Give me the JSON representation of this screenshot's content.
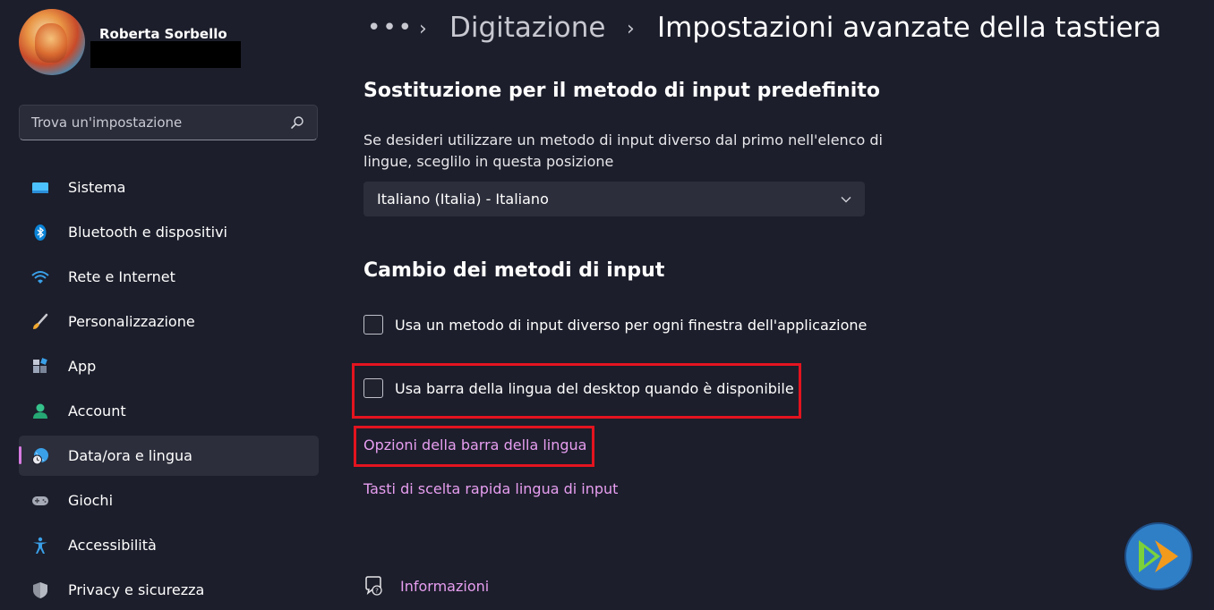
{
  "user": {
    "name": "Roberta Sorbello"
  },
  "search": {
    "placeholder": "Trova un'impostazione"
  },
  "nav": {
    "items": [
      {
        "label": "Sistema"
      },
      {
        "label": "Bluetooth e dispositivi"
      },
      {
        "label": "Rete e Internet"
      },
      {
        "label": "Personalizzazione"
      },
      {
        "label": "App"
      },
      {
        "label": "Account"
      },
      {
        "label": "Data/ora e lingua"
      },
      {
        "label": "Giochi"
      },
      {
        "label": "Accessibilità"
      },
      {
        "label": "Privacy e sicurezza"
      }
    ],
    "active": "Data/ora e lingua"
  },
  "breadcrumb": {
    "dots": "•••",
    "separator": "›",
    "parent": "Digitazione",
    "current": "Impostazioni avanzate della tastiera"
  },
  "override": {
    "title": "Sostituzione per il metodo di input predefinito",
    "description": "Se desideri utilizzare un metodo di input diverso dal primo nell'elenco di lingue, sceglilo in questa posizione",
    "selected": "Italiano (Italia) - Italiano"
  },
  "switching": {
    "title": "Cambio dei metodi di input",
    "checkbox1": {
      "label": "Usa un metodo di input diverso per ogni finestra dell'applicazione",
      "checked": false
    },
    "checkbox2": {
      "label": "Usa barra della lingua del desktop quando è disponibile",
      "checked": false
    },
    "link1": "Opzioni della barra della lingua",
    "link2": "Tasti di scelta rapida lingua di input"
  },
  "help": {
    "label": "Informazioni"
  },
  "colors": {
    "background": "#1c1e2b",
    "accent_link": "#e79ef0",
    "active_indicator": "#d77ae0",
    "highlight_box": "#e3141f"
  },
  "icons": [
    "search-icon",
    "monitor-icon",
    "bluetooth-icon",
    "wifi-icon",
    "brush-icon",
    "apps-icon",
    "person-icon",
    "globe-clock-icon",
    "gamepad-icon",
    "accessibility-icon",
    "shield-icon",
    "chevron-down-icon",
    "help-chat-icon"
  ]
}
